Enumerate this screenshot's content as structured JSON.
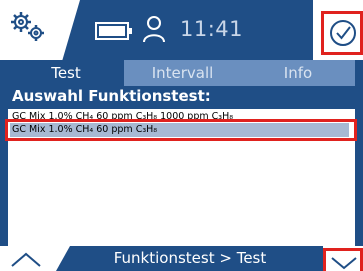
{
  "status": {
    "time": "11:41",
    "icons": [
      "gears-icon",
      "battery-icon",
      "user-icon",
      "check-circle-icon"
    ]
  },
  "tabs": [
    {
      "label": "Test",
      "active": true
    },
    {
      "label": "Intervall",
      "active": false
    },
    {
      "label": "Info",
      "active": false
    }
  ],
  "panel": {
    "heading": "Auswahl Funktionstest:",
    "items": [
      {
        "label": "GC Mix 1.0% CH₄ 60 ppm C₃H₈ 1000 ppm C₃H₈",
        "selected": false
      },
      {
        "label": "GC Mix 1.0% CH₄ 60 ppm C₃H₈",
        "selected": true
      }
    ]
  },
  "footer": {
    "breadcrumb": "Funktionstest > Test",
    "icons": [
      "chevron-up-icon",
      "chevron-down-icon"
    ]
  },
  "colors": {
    "background": "#1f4e86",
    "inactive_tab": "#6a8fbf",
    "selection": "#a7b9d3",
    "highlight": "#e0221e"
  }
}
